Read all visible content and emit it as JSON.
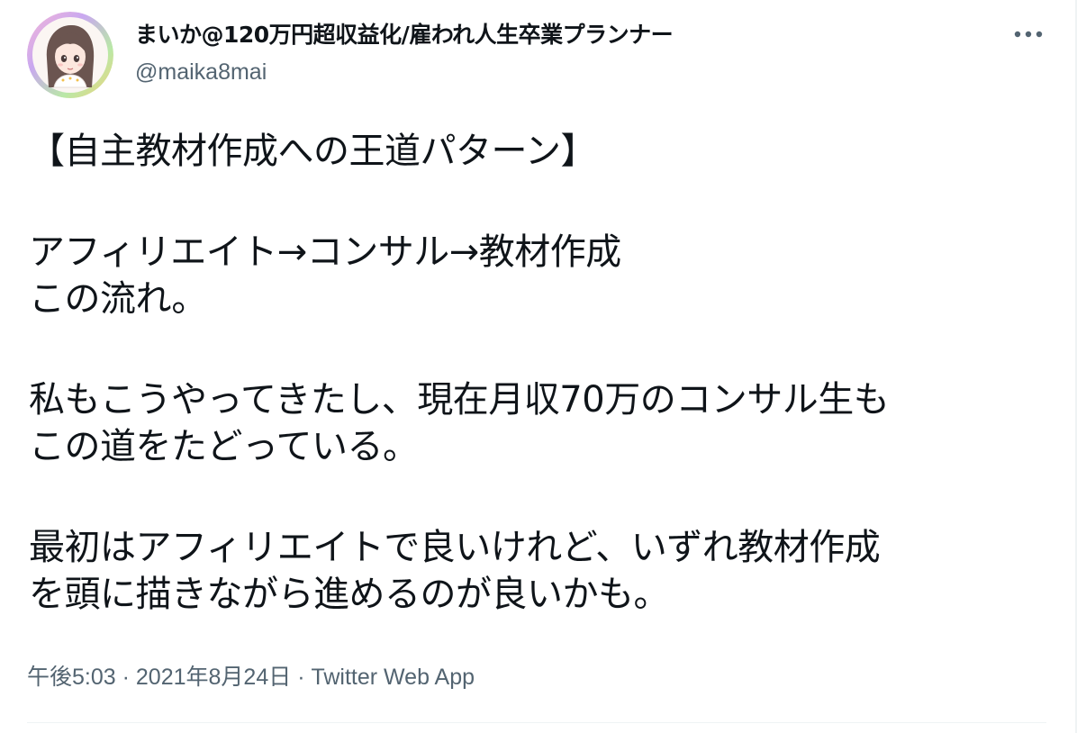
{
  "author": {
    "display_name": "まいか@120万円超収益化/雇われ人生卒業プランナー",
    "handle": "@maika8mai"
  },
  "more_icon": "more-dots-icon",
  "tweet": {
    "lines": {
      "l1": "【自主教材作成への王道パターン】",
      "l2": "アフィリエイト→コンサル→教材作成",
      "l3": "この流れ。",
      "l4": "私もこうやってきたし、現在月収70万のコンサル生も",
      "l5": "この道をたどっている。",
      "l6": "最初はアフィリエイトで良いけれど、いずれ教材作成",
      "l7": "を頭に描きながら進めるのが良いかも。"
    }
  },
  "meta": {
    "time": "午後5:03",
    "separator": "·",
    "date": "2021年8月24日",
    "source": "Twitter Web App"
  },
  "colors": {
    "text": "#0f1419",
    "secondary": "#536471",
    "divider": "#eff3f4"
  }
}
